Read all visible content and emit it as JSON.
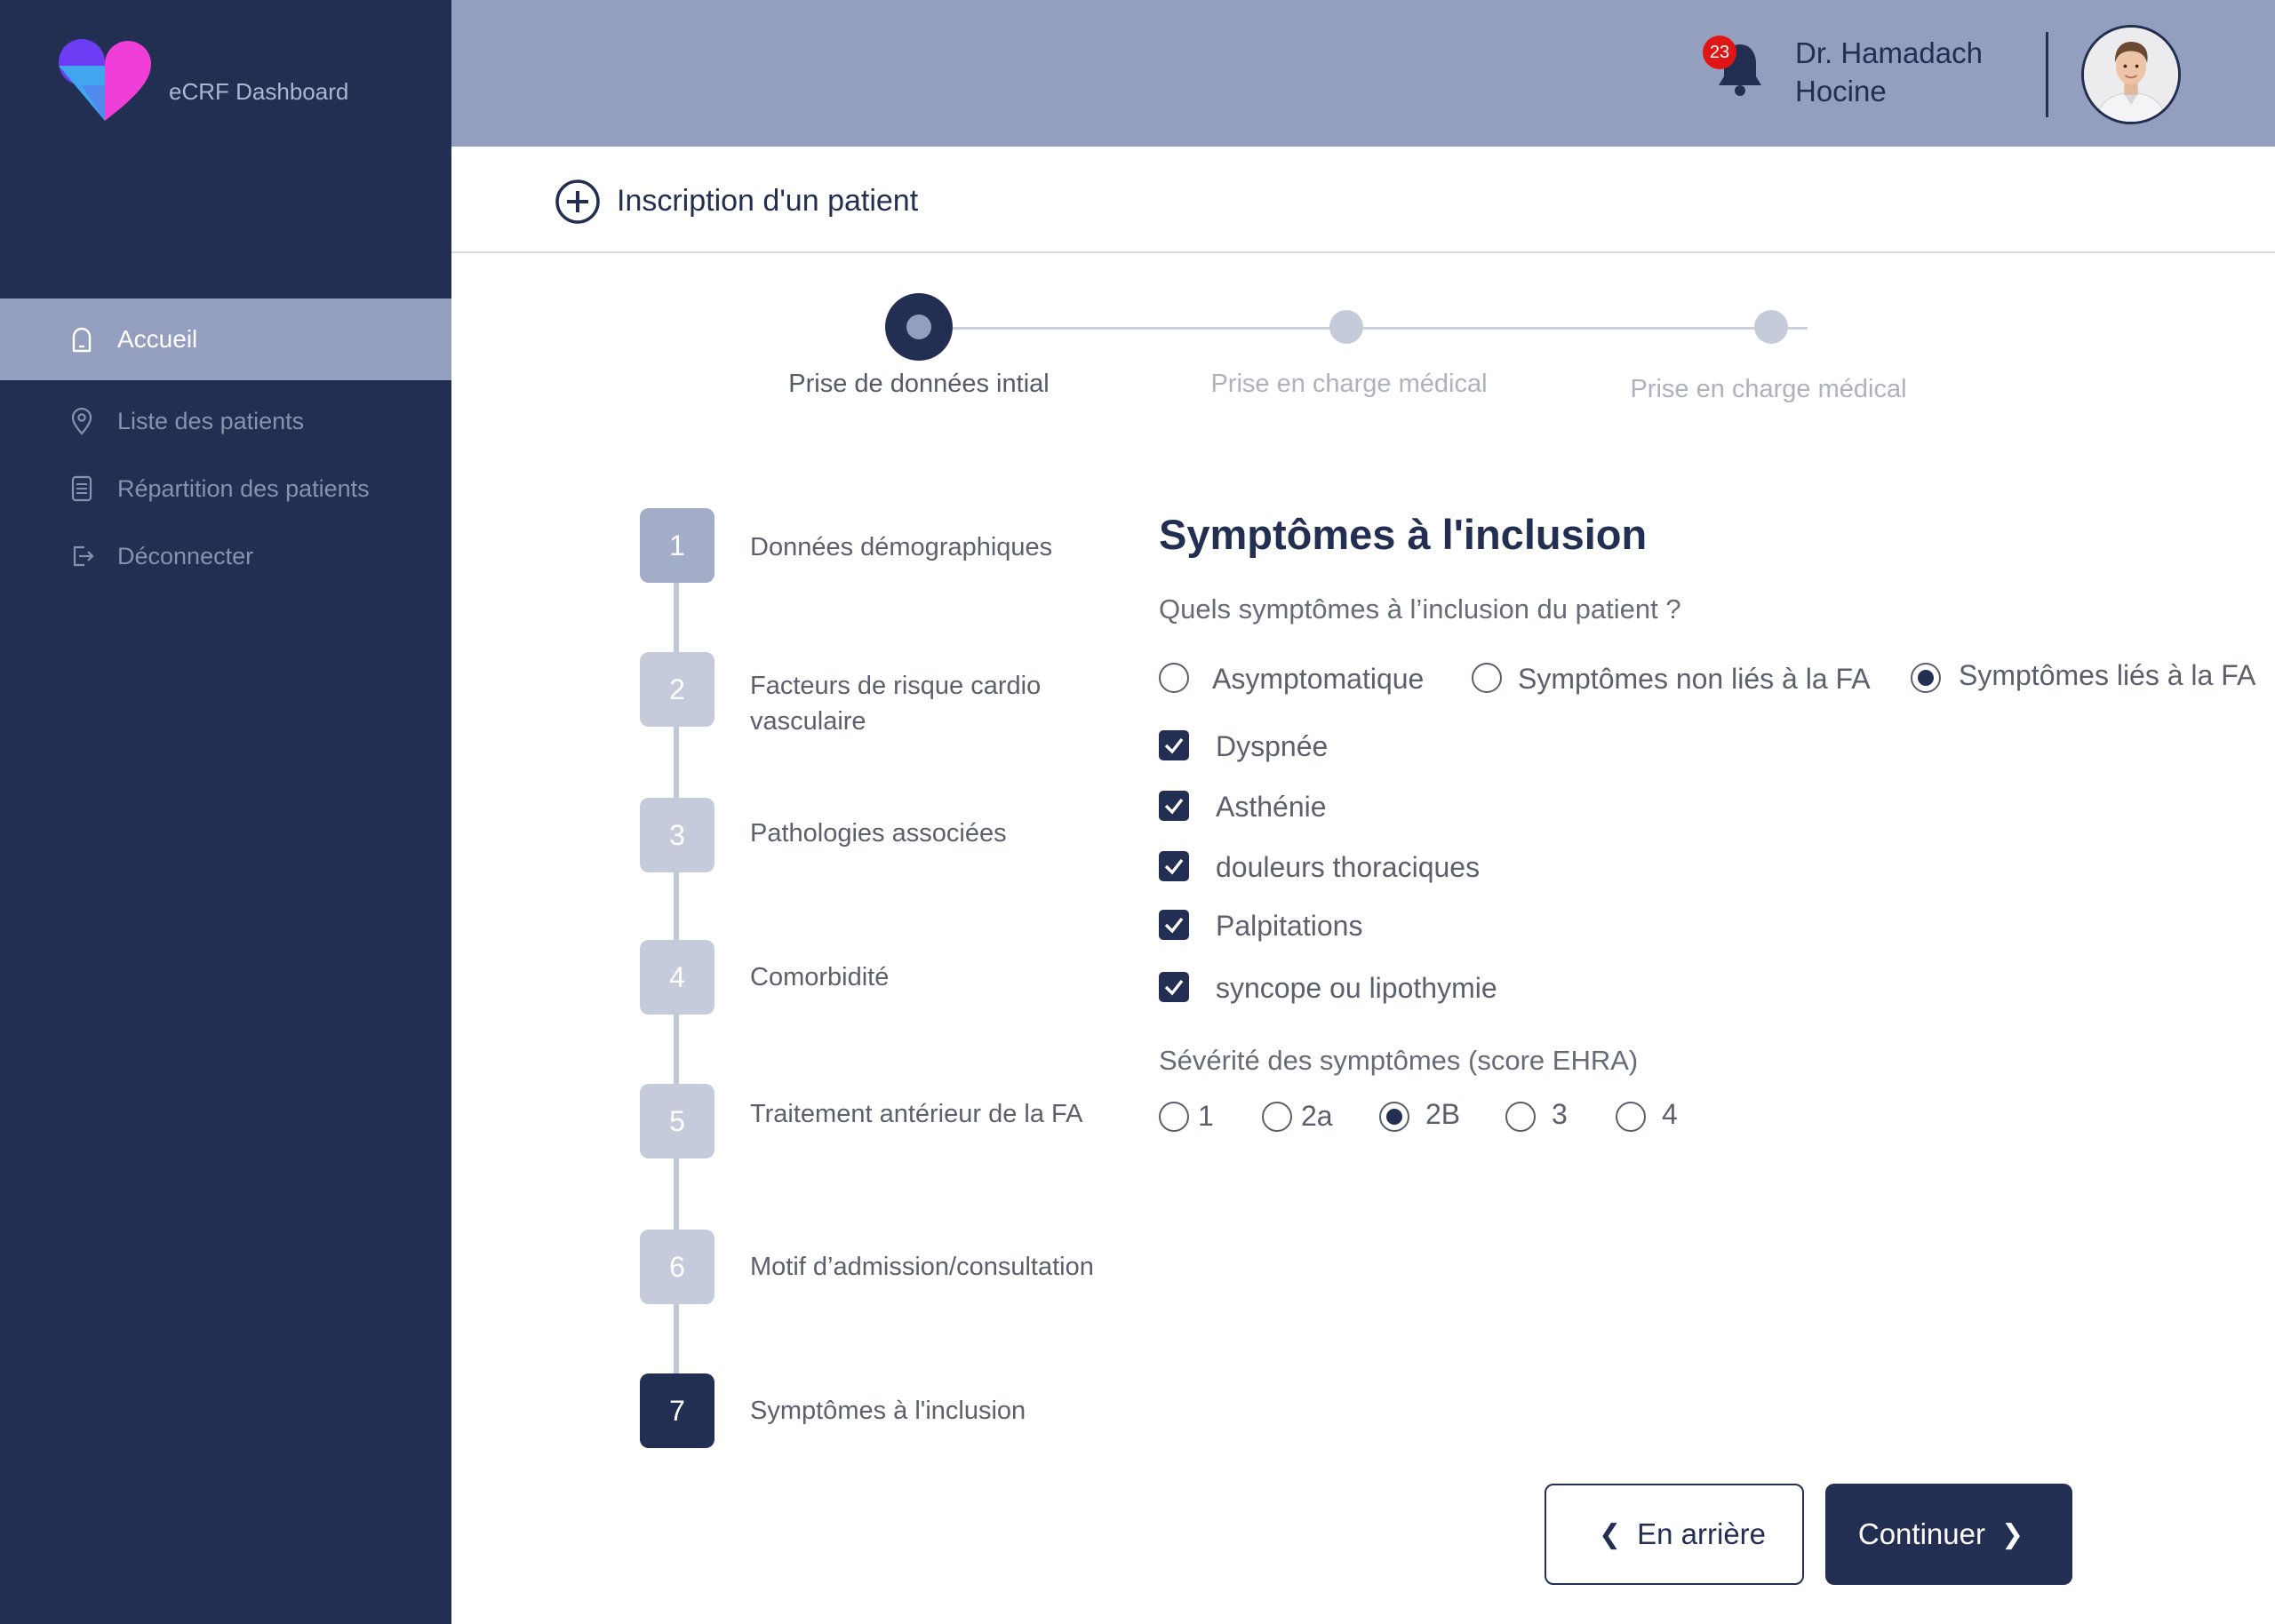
{
  "sidebar": {
    "brand": "eCRF Dashboard",
    "items": [
      {
        "label": "Accueil",
        "icon": "home-icon",
        "active": true
      },
      {
        "label": "Liste des patients",
        "icon": "location-pin-icon",
        "active": false
      },
      {
        "label": "Répartition  des patients",
        "icon": "document-list-icon",
        "active": false
      },
      {
        "label": "Déconnecter",
        "icon": "logout-icon",
        "active": false
      }
    ]
  },
  "header": {
    "notification_count": "23",
    "user_first_line": "Dr. Hamadach",
    "user_second_line": "Hocine"
  },
  "page": {
    "title": "Inscription d'un patient"
  },
  "top_stepper": [
    {
      "label": "Prise de données intial",
      "state": "active"
    },
    {
      "label": "Prise en charge médical",
      "state": "pending"
    },
    {
      "label": "Prise en charge médical",
      "state": "pending"
    }
  ],
  "steps": [
    {
      "number": "1",
      "label": "Données démographiques",
      "state": "done"
    },
    {
      "number": "2",
      "label": "Facteurs de risque cardio vasculaire",
      "state": "pending"
    },
    {
      "number": "3",
      "label": "Pathologies associées",
      "state": "pending"
    },
    {
      "number": "4",
      "label": "Comorbidité",
      "state": "pending"
    },
    {
      "number": "5",
      "label": "Traitement antérieur de la FA",
      "state": "pending"
    },
    {
      "number": "6",
      "label": "Motif d’admission/consultation",
      "state": "pending"
    },
    {
      "number": "7",
      "label": "Symptômes à l'inclusion",
      "state": "current"
    }
  ],
  "form": {
    "title": "Symptômes à l'inclusion",
    "question": "Quels symptômes à l’inclusion du patient ?",
    "symptom_type_options": [
      {
        "label": "Asymptomatique",
        "checked": false
      },
      {
        "label": "Symptômes non liés à la FA",
        "checked": false
      },
      {
        "label": "Symptômes liés à la FA",
        "checked": true
      }
    ],
    "symptoms": [
      {
        "label": "Dyspnée",
        "checked": true
      },
      {
        "label": "Asthénie",
        "checked": true
      },
      {
        "label": "douleurs thoraciques",
        "checked": true
      },
      {
        "label": "Palpitations",
        "checked": true
      },
      {
        "label": "syncope ou lipothymie",
        "checked": true
      }
    ],
    "severity_label": "Sévérité des symptômes (score EHRA)",
    "severity_options": [
      {
        "label": "1",
        "checked": false
      },
      {
        "label": "2a",
        "checked": false
      },
      {
        "label": "2B",
        "checked": true
      },
      {
        "label": "3",
        "checked": false
      },
      {
        "label": "4",
        "checked": false
      }
    ]
  },
  "buttons": {
    "back": "En arrière",
    "next": "Continuer"
  },
  "colors": {
    "navy": "#232f52",
    "slate": "#949fc0",
    "badge_red": "#e01616"
  }
}
